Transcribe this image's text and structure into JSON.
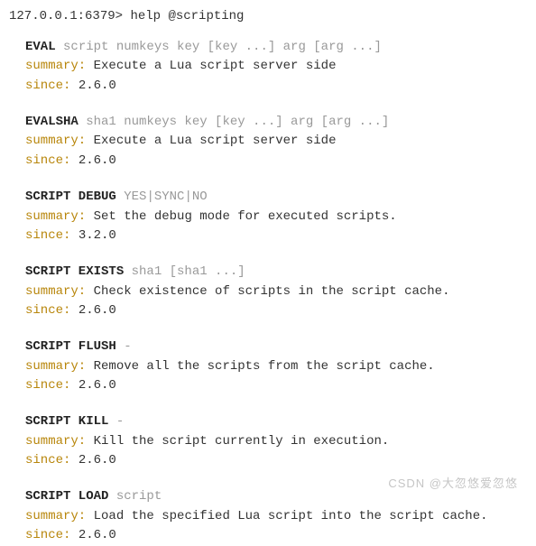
{
  "prompt": "127.0.0.1:6379>",
  "prompt_command": "help @scripting",
  "commands": [
    {
      "name": "EVAL",
      "args": "script numkeys key [key ...] arg [arg ...]",
      "summary_label": "summary:",
      "summary": "Execute a Lua script server side",
      "since_label": "since:",
      "since": "2.6.0"
    },
    {
      "name": "EVALSHA",
      "args": "sha1 numkeys key [key ...] arg [arg ...]",
      "summary_label": "summary:",
      "summary": "Execute a Lua script server side",
      "since_label": "since:",
      "since": "2.6.0"
    },
    {
      "name": "SCRIPT DEBUG",
      "args": "YES|SYNC|NO",
      "summary_label": "summary:",
      "summary": "Set the debug mode for executed scripts.",
      "since_label": "since:",
      "since": "3.2.0"
    },
    {
      "name": "SCRIPT EXISTS",
      "args": "sha1 [sha1 ...]",
      "summary_label": "summary:",
      "summary": "Check existence of scripts in the script cache.",
      "since_label": "since:",
      "since": "2.6.0"
    },
    {
      "name": "SCRIPT FLUSH",
      "args": "-",
      "summary_label": "summary:",
      "summary": "Remove all the scripts from the script cache.",
      "since_label": "since:",
      "since": "2.6.0"
    },
    {
      "name": "SCRIPT KILL",
      "args": "-",
      "summary_label": "summary:",
      "summary": "Kill the script currently in execution.",
      "since_label": "since:",
      "since": "2.6.0"
    },
    {
      "name": "SCRIPT LOAD",
      "args": "script",
      "summary_label": "summary:",
      "summary": "Load the specified Lua script into the script cache.",
      "since_label": "since:",
      "since": "2.6.0"
    }
  ],
  "watermark": "CSDN @大忽悠爱忽悠"
}
